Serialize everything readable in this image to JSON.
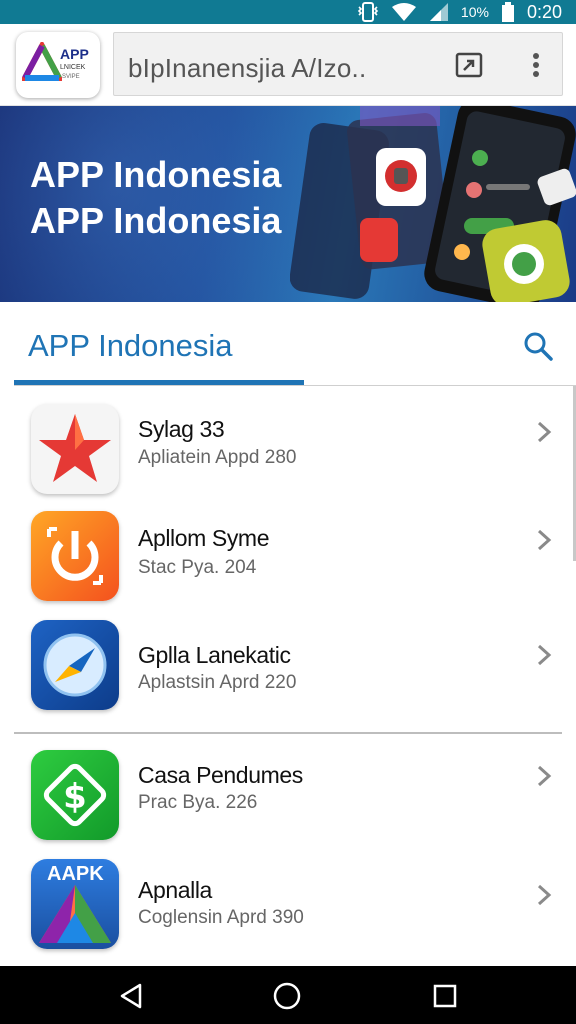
{
  "status_bar": {
    "battery_percent": "10%",
    "time": "0:20",
    "icons": [
      "vibrate-icon",
      "wifi-icon",
      "signal-icon",
      "battery-icon"
    ]
  },
  "app_bar": {
    "logo": {
      "line1": "APP",
      "line2": "LNICEK",
      "line3": "SVIPE"
    },
    "url_text": "bIpInanensjia A/Izo..",
    "icons": [
      "share-icon",
      "overflow-menu-icon"
    ]
  },
  "banner": {
    "line1": "APP Indonesia",
    "line2": "APP Indonesia"
  },
  "section": {
    "title": "APP Indonesia",
    "accent_color": "#1f74b5"
  },
  "apps": [
    {
      "name": "Sylag 33",
      "subtitle": "Apliatein Appd 280",
      "icon": "star-icon"
    },
    {
      "name": "Apllom Syme",
      "subtitle": "Stac Pya. 204",
      "icon": "power-icon"
    },
    {
      "name": "Gplla Lanekatic",
      "subtitle": "Aplastsin Aprd 220",
      "icon": "compass-icon"
    },
    {
      "name": "Casa Pendumes",
      "subtitle": "Prac Bya. 226",
      "icon": "dollar-icon"
    },
    {
      "name": "Apnalla",
      "subtitle": "Coglensin Aprd 390",
      "icon": "aapk-icon",
      "icon_text": "AAPK"
    }
  ],
  "nav_bar": [
    "back-icon",
    "home-icon",
    "recents-icon"
  ]
}
